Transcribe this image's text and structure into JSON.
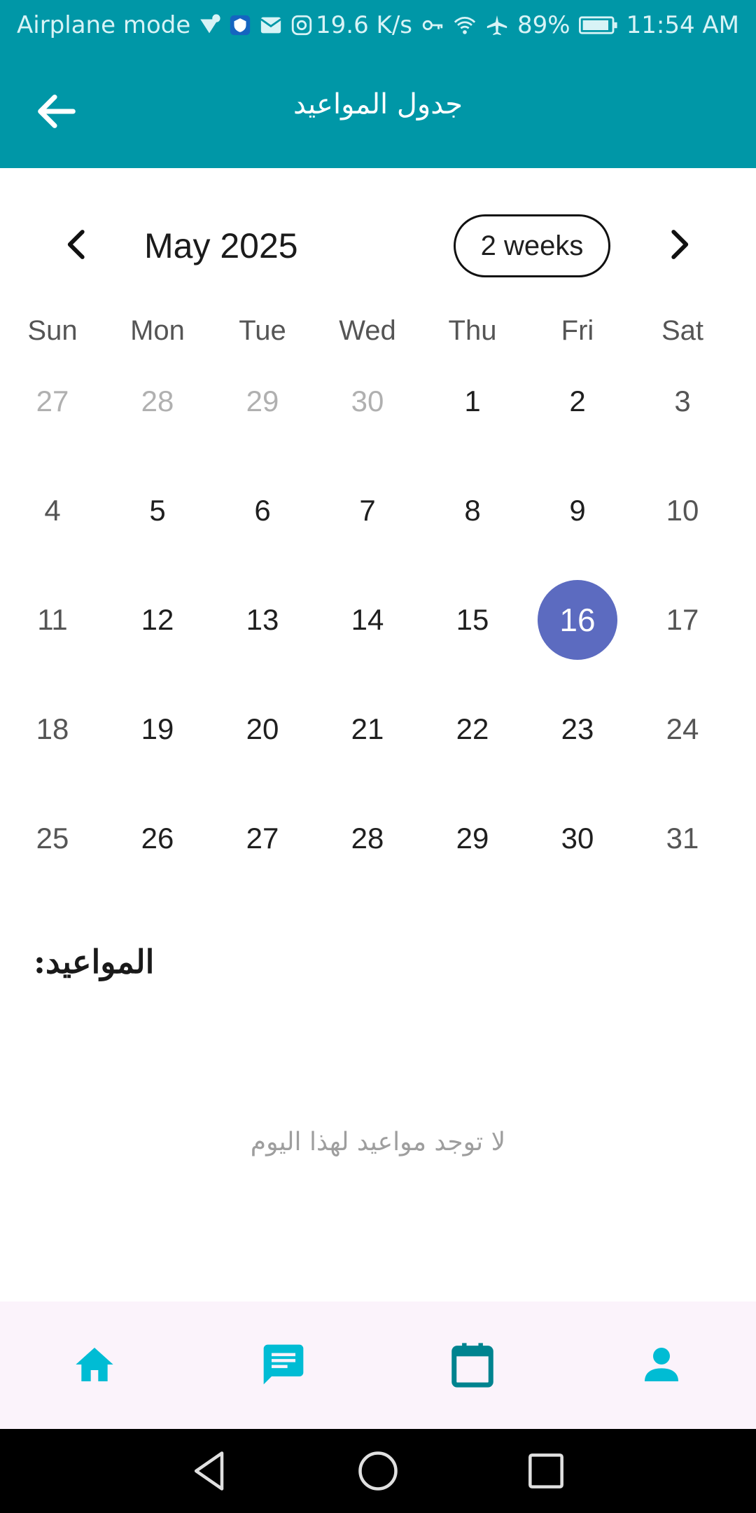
{
  "status_bar": {
    "left_text": "Airplane mode",
    "speed": "19.6 K/s",
    "battery": "89%",
    "time": "11:54 AM"
  },
  "app_bar": {
    "title": "جدول المواعيد"
  },
  "calendar": {
    "month_title": "May 2025",
    "format_button": "2 weeks",
    "weekdays": [
      "Sun",
      "Mon",
      "Tue",
      "Wed",
      "Thu",
      "Fri",
      "Sat"
    ],
    "weeks": [
      [
        "27",
        "28",
        "29",
        "30",
        "1",
        "2",
        "3"
      ],
      [
        "4",
        "5",
        "6",
        "7",
        "8",
        "9",
        "10"
      ],
      [
        "11",
        "12",
        "13",
        "14",
        "15",
        "16",
        "17"
      ],
      [
        "18",
        "19",
        "20",
        "21",
        "22",
        "23",
        "24"
      ],
      [
        "25",
        "26",
        "27",
        "28",
        "29",
        "30",
        "31"
      ]
    ],
    "selected_day": "16",
    "selected_color": "#5c6bc0"
  },
  "appointments": {
    "title": "المواعيد:",
    "empty_message": "لا توجد مواعيد لهذا اليوم"
  },
  "bottom_nav": {
    "items": [
      {
        "icon": "home-icon",
        "color": "#00bcd4"
      },
      {
        "icon": "chat-icon",
        "color": "#00bcd4"
      },
      {
        "icon": "calendar-icon",
        "color": "#00838f"
      },
      {
        "icon": "person-icon",
        "color": "#00bcd4"
      }
    ]
  },
  "colors": {
    "primary": "#0097a7",
    "nav_background": "#fbf3fb"
  }
}
